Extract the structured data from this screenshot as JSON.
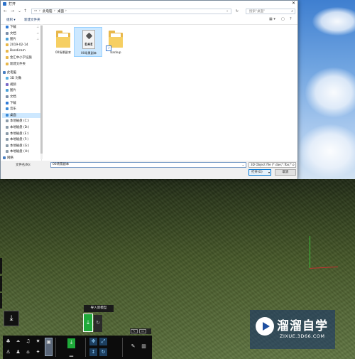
{
  "dialog": {
    "title": "打开",
    "close": "✕",
    "nav": {
      "back": "←",
      "forward": "→",
      "up_menu": "⌄",
      "up": "↑"
    },
    "address": {
      "crumbs": [
        "此电脑",
        "›",
        "桌面",
        "›"
      ],
      "dropdown": "⌄",
      "refresh": "↻"
    },
    "search": {
      "placeholder": "搜索\"桌面\"",
      "icon": "🔍"
    },
    "toolbar": {
      "organize": "组织 ▾",
      "new_folder": "新建文件夹",
      "view_icon": "▦ ▾",
      "pane_icon": "▢",
      "help_icon": "?"
    },
    "sidebar": [
      {
        "label": "下载",
        "icon": "download-icon",
        "pinned": true
      },
      {
        "label": "文档",
        "icon": "document-icon",
        "pinned": true
      },
      {
        "label": "图片",
        "icon": "picture-icon",
        "pinned": true
      },
      {
        "label": "2019-02-14",
        "icon": "folder-icon"
      },
      {
        "label": "Bandicam",
        "icon": "folder-icon"
      },
      {
        "label": "金汇中小学设施",
        "icon": "folder-icon"
      },
      {
        "label": "新建文件夹",
        "icon": "folder-icon"
      },
      {
        "label": "此电脑",
        "icon": "computer-icon",
        "section": true
      },
      {
        "label": "3D 对象",
        "icon": "cube-icon"
      },
      {
        "label": "视频",
        "icon": "video-icon"
      },
      {
        "label": "图片",
        "icon": "picture-icon"
      },
      {
        "label": "文档",
        "icon": "document-icon"
      },
      {
        "label": "下载",
        "icon": "download-icon"
      },
      {
        "label": "音乐",
        "icon": "music-icon"
      },
      {
        "label": "桌面",
        "icon": "desktop-icon",
        "selected": true
      },
      {
        "label": "本地磁盘 (C:)",
        "icon": "drive-icon"
      },
      {
        "label": "本地磁盘 (D:)",
        "icon": "drive-icon"
      },
      {
        "label": "本地磁盘 (E:)",
        "icon": "drive-icon"
      },
      {
        "label": "本地磁盘 (F:)",
        "icon": "drive-icon"
      },
      {
        "label": "本地磁盘 (G:)",
        "icon": "drive-icon"
      },
      {
        "label": "本地磁盘 (H:)",
        "icon": "drive-icon"
      },
      {
        "label": "网络",
        "icon": "network-icon"
      }
    ],
    "files": [
      {
        "name": "00场景副本",
        "type": "folder"
      },
      {
        "name": "00场景副本",
        "type": "dae",
        "ext": "DAE",
        "selected": true
      },
      {
        "name": "backup",
        "type": "folder-shortcut"
      }
    ],
    "footer": {
      "filename_label": "文件名(N):",
      "filename_value": "00场景副本",
      "filetype": "3D Object file (*.dae;*.fbx;*.o",
      "open_button": "打开(O)",
      "open_dropdown": "▾",
      "cancel_button": "取消"
    }
  },
  "tooltip": "导入新模型",
  "tools": {
    "download_big": "⤓",
    "import_icon": "⤓",
    "refresh_icon": "↻"
  },
  "watermark": {
    "name": "溜溜自学",
    "url": "ZIXUE.3D66.COM"
  },
  "colors": {
    "accent_green": "#1faa3a",
    "selection_blue": "#cce8ff",
    "folder_yellow": "#f6cf62"
  }
}
